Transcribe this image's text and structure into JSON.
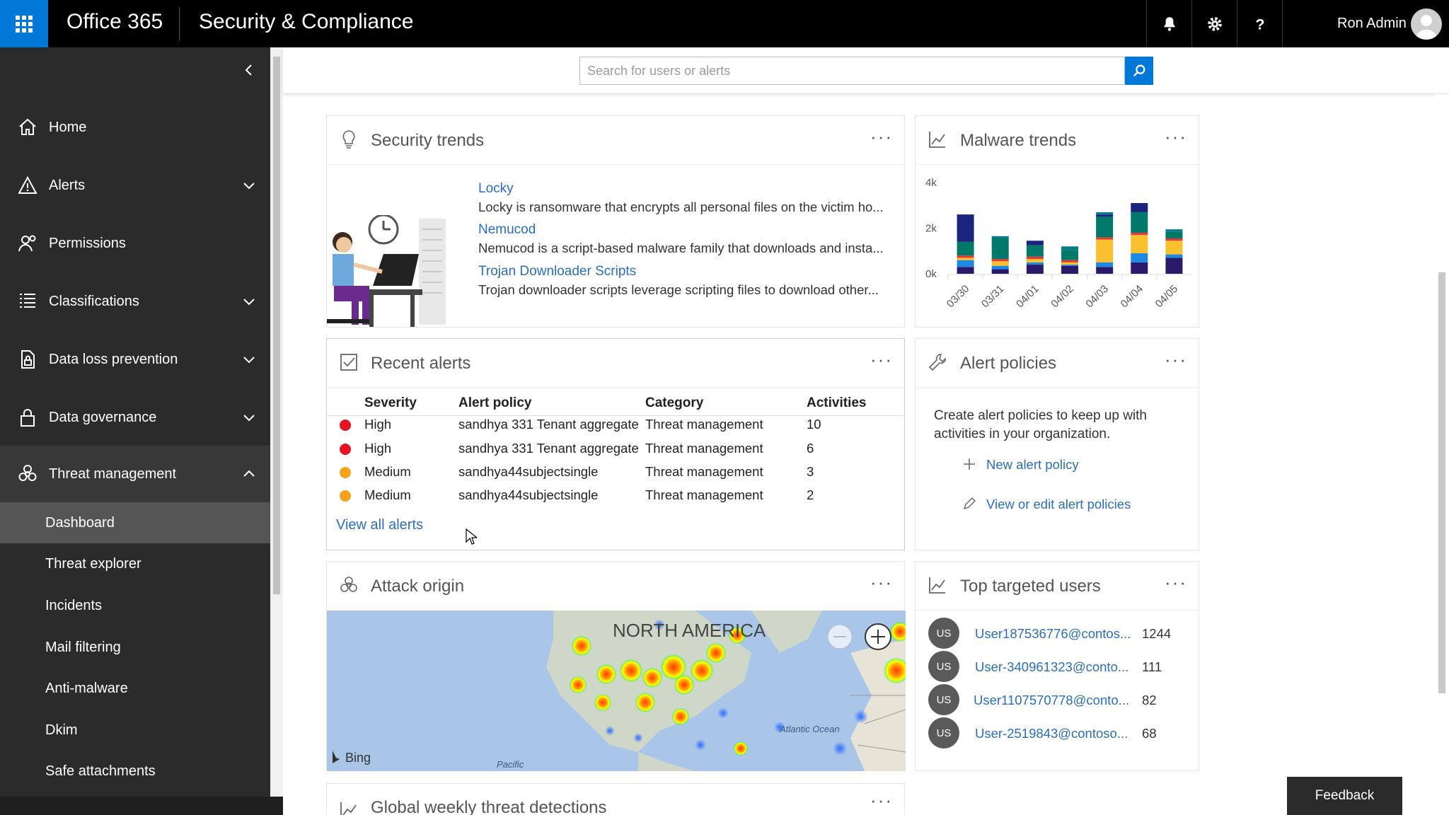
{
  "header": {
    "brand": "Office 365",
    "app_title": "Security & Compliance",
    "user_name": "Ron Admin"
  },
  "search": {
    "placeholder": "Search for users or alerts"
  },
  "sidebar": {
    "items": [
      {
        "label": "Home",
        "icon": "home-icon"
      },
      {
        "label": "Alerts",
        "icon": "warning-icon"
      },
      {
        "label": "Permissions",
        "icon": "people-icon"
      },
      {
        "label": "Classifications",
        "icon": "list-icon"
      },
      {
        "label": "Data loss prevention",
        "icon": "document-lock-icon"
      },
      {
        "label": "Data governance",
        "icon": "lock-icon"
      },
      {
        "label": "Threat management",
        "icon": "biohazard-icon"
      }
    ],
    "sub_items": [
      {
        "label": "Dashboard"
      },
      {
        "label": "Threat explorer"
      },
      {
        "label": "Incidents"
      },
      {
        "label": "Mail filtering"
      },
      {
        "label": "Anti-malware"
      },
      {
        "label": "Dkim"
      },
      {
        "label": "Safe attachments"
      }
    ]
  },
  "security_trends": {
    "title": "Security trends",
    "items": [
      {
        "title": "Locky",
        "desc": "Locky is ransomware that encrypts all personal files on the victim ho..."
      },
      {
        "title": "Nemucod",
        "desc": "Nemucod is a script-based malware family that downloads and insta..."
      },
      {
        "title": "Trojan Downloader Scripts",
        "desc": "Trojan downloader scripts leverage scripting files to download other..."
      }
    ]
  },
  "malware_trends": {
    "title": "Malware trends"
  },
  "recent_alerts": {
    "title": "Recent alerts",
    "columns": [
      "Severity",
      "Alert policy",
      "Category",
      "Activities"
    ],
    "rows": [
      {
        "severity": "High",
        "policy": "sandhya 331 Tenant aggregate",
        "category": "Threat management",
        "activities": "10",
        "color": "#e81123"
      },
      {
        "severity": "High",
        "policy": "sandhya 331 Tenant aggregate",
        "category": "Threat management",
        "activities": "6",
        "color": "#e81123"
      },
      {
        "severity": "Medium",
        "policy": "sandhya44subjectsingle",
        "category": "Threat management",
        "activities": "3",
        "color": "#f7a21b"
      },
      {
        "severity": "Medium",
        "policy": "sandhya44subjectsingle",
        "category": "Threat management",
        "activities": "2",
        "color": "#f7a21b"
      }
    ],
    "view_all": "View all alerts"
  },
  "alert_policies": {
    "title": "Alert policies",
    "text": "Create alert policies to keep up with activities in your organization.",
    "new_policy": "New alert policy",
    "view_policies": "View or edit alert policies"
  },
  "attack_origin": {
    "title": "Attack origin",
    "map_labels": {
      "region": "NORTH AMERICA",
      "ocean1": "Atlantic Ocean",
      "ocean2": "Pacific",
      "provider": "Bing"
    }
  },
  "top_targeted": {
    "title": "Top targeted users",
    "users": [
      {
        "badge": "US",
        "name": "User187536776@contos...",
        "count": "1244"
      },
      {
        "badge": "US",
        "name": "User-340961323@conto...",
        "count": "111"
      },
      {
        "badge": "US",
        "name": "User1107570778@conto...",
        "count": "82"
      },
      {
        "badge": "US",
        "name": "User-2519843@contoso...",
        "count": "68"
      }
    ]
  },
  "global_weekly": {
    "title": "Global weekly threat detections"
  },
  "feedback": "Feedback",
  "chart_data": {
    "type": "bar",
    "stacked": true,
    "categories": [
      "03/30",
      "03/31",
      "04/01",
      "04/02",
      "04/03",
      "04/04",
      "04/05"
    ],
    "yticks": [
      "0k",
      "2k",
      "4k"
    ],
    "ylim": [
      0,
      4000
    ],
    "series": [
      {
        "color": "#2b1a6b",
        "values": [
          300,
          200,
          400,
          350,
          300,
          500,
          700
        ]
      },
      {
        "color": "#1e88e5",
        "values": [
          300,
          150,
          100,
          50,
          200,
          400,
          150
        ]
      },
      {
        "color": "#fbc02d",
        "values": [
          100,
          200,
          150,
          100,
          1000,
          800,
          600
        ]
      },
      {
        "color": "#e53935",
        "values": [
          100,
          100,
          100,
          100,
          100,
          100,
          100
        ]
      },
      {
        "color": "#00796b",
        "values": [
          600,
          900,
          500,
          450,
          900,
          900,
          300
        ]
      },
      {
        "color": "#1a237e",
        "values": [
          1200,
          0,
          200,
          0,
          100,
          400,
          0
        ]
      },
      {
        "color": "#0b7a8a",
        "values": [
          0,
          100,
          0,
          150,
          100,
          0,
          100
        ]
      }
    ]
  }
}
